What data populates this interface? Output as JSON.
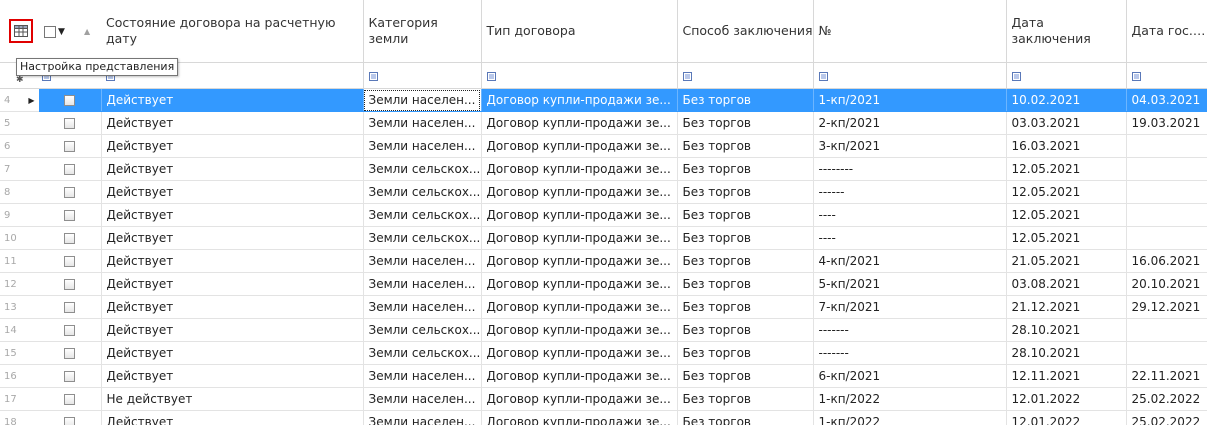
{
  "header": {
    "columns": [
      "Состояние договора на расчетную дату",
      "Категория земли",
      "Тип договора",
      "Способ заключения",
      "№",
      "Дата заключения",
      "Дата гос. ре"
    ],
    "view_settings_icon": "grid-settings-icon",
    "tooltip": "Настройка представления"
  },
  "rows": [
    {
      "n": "4",
      "state": "Действует",
      "land": "Земли населен...",
      "type": "Договор купли-продажи зе...",
      "method": "Без торгов",
      "num": "1-кп/2021",
      "date": "10.02.2021",
      "reg": "04.03.2021"
    },
    {
      "n": "5",
      "state": "Действует",
      "land": "Земли населен...",
      "type": "Договор купли-продажи зе...",
      "method": "Без торгов",
      "num": "2-кп/2021",
      "date": "03.03.2021",
      "reg": "19.03.2021"
    },
    {
      "n": "6",
      "state": "Действует",
      "land": "Земли населен...",
      "type": "Договор купли-продажи зе...",
      "method": "Без торгов",
      "num": "3-кп/2021",
      "date": "16.03.2021",
      "reg": ""
    },
    {
      "n": "7",
      "state": "Действует",
      "land": "Земли сельскох...",
      "type": "Договор купли-продажи зе...",
      "method": "Без торгов",
      "num": "--------",
      "date": "12.05.2021",
      "reg": ""
    },
    {
      "n": "8",
      "state": "Действует",
      "land": "Земли сельскох...",
      "type": "Договор купли-продажи зе...",
      "method": "Без торгов",
      "num": "------",
      "date": "12.05.2021",
      "reg": ""
    },
    {
      "n": "9",
      "state": "Действует",
      "land": "Земли сельскох...",
      "type": "Договор купли-продажи зе...",
      "method": "Без торгов",
      "num": "----",
      "date": "12.05.2021",
      "reg": ""
    },
    {
      "n": "10",
      "state": "Действует",
      "land": "Земли сельскох...",
      "type": "Договор купли-продажи зе...",
      "method": "Без торгов",
      "num": "----",
      "date": "12.05.2021",
      "reg": ""
    },
    {
      "n": "11",
      "state": "Действует",
      "land": "Земли населен...",
      "type": "Договор купли-продажи зе...",
      "method": "Без торгов",
      "num": "4-кп/2021",
      "date": "21.05.2021",
      "reg": "16.06.2021"
    },
    {
      "n": "12",
      "state": "Действует",
      "land": "Земли населен...",
      "type": "Договор купли-продажи зе...",
      "method": "Без торгов",
      "num": "5-кп/2021",
      "date": "03.08.2021",
      "reg": "20.10.2021"
    },
    {
      "n": "13",
      "state": "Действует",
      "land": "Земли населен...",
      "type": "Договор купли-продажи зе...",
      "method": "Без торгов",
      "num": "7-кп/2021",
      "date": "21.12.2021",
      "reg": "29.12.2021"
    },
    {
      "n": "14",
      "state": "Действует",
      "land": "Земли сельскох...",
      "type": "Договор купли-продажи зе...",
      "method": "Без торгов",
      "num": "-------",
      "date": "28.10.2021",
      "reg": ""
    },
    {
      "n": "15",
      "state": "Действует",
      "land": "Земли сельскох...",
      "type": "Договор купли-продажи зе...",
      "method": "Без торгов",
      "num": "-------",
      "date": "28.10.2021",
      "reg": ""
    },
    {
      "n": "16",
      "state": "Действует",
      "land": "Земли населен...",
      "type": "Договор купли-продажи зе...",
      "method": "Без торгов",
      "num": "6-кп/2021",
      "date": "12.11.2021",
      "reg": "22.11.2021"
    },
    {
      "n": "17",
      "state": "Не действует",
      "land": "Земли населен...",
      "type": "Договор купли-продажи зе...",
      "method": "Без торгов",
      "num": "1-кп/2022",
      "date": "12.01.2022",
      "reg": "25.02.2022"
    },
    {
      "n": "18",
      "state": "Действует",
      "land": "Земли населен...",
      "type": "Договор купли-продажи зе...",
      "method": "Без торгов",
      "num": "1-кп/2022",
      "date": "12.01.2022",
      "reg": "25.02.2022"
    }
  ],
  "selected_row": "4",
  "colors": {
    "selection": "#3399ff",
    "highlight_border": "#e00000"
  }
}
